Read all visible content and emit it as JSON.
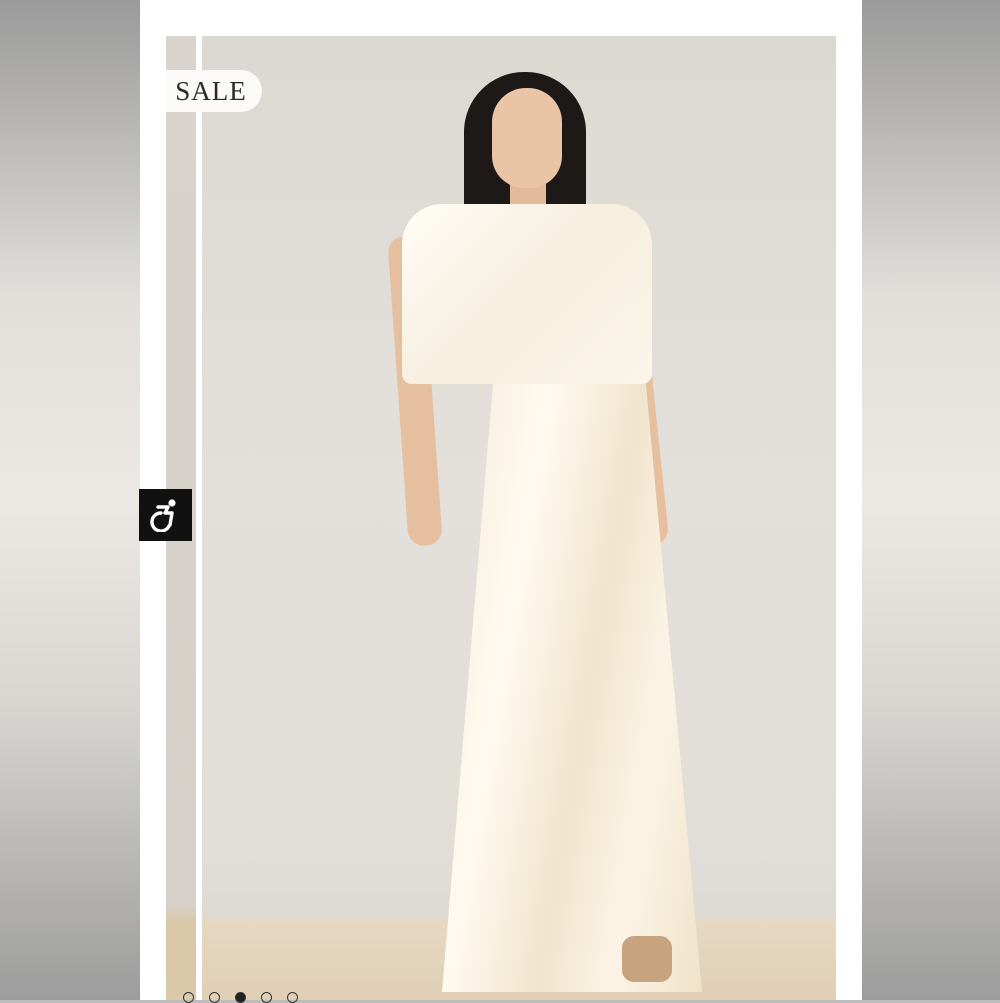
{
  "product_gallery": {
    "badge": {
      "label": "SALE"
    },
    "main_image": {
      "subject": "model-wearing-ivory-satin-maxi-dress"
    },
    "pagination": {
      "total": 5,
      "active_index": 2
    }
  },
  "accessibility_widget": {
    "icon": "wheelchair-icon"
  },
  "colors": {
    "badge_bg": "#fbfaf8",
    "badge_text": "#2a2a2a",
    "widget_bg": "#111111",
    "dot_border": "#333333",
    "dot_active": "#222222"
  }
}
